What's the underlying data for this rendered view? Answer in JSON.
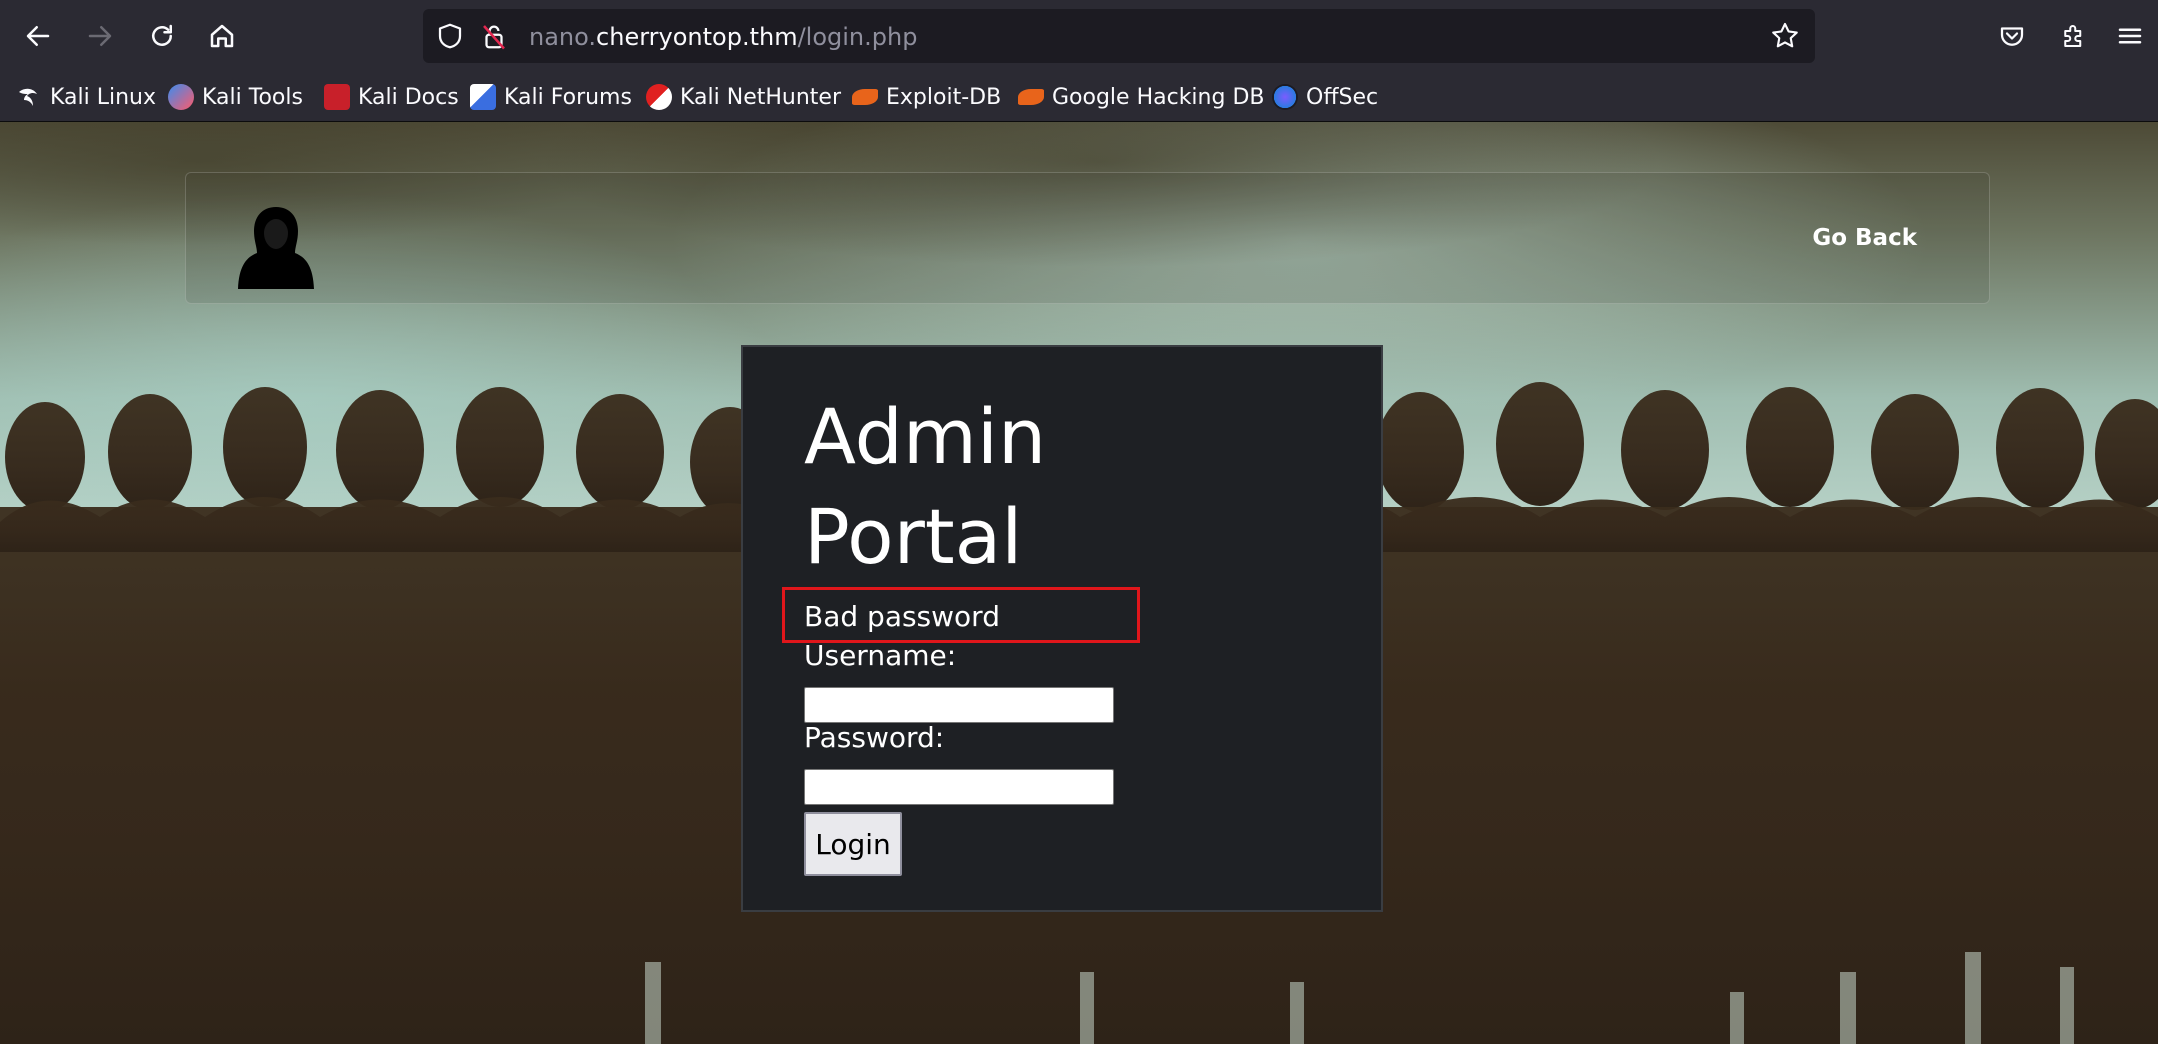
{
  "browser": {
    "url_prefix": "nano.",
    "url_host": "cherryontop.thm",
    "url_path": "/login.php",
    "bookmarks": [
      {
        "label": "Kali Linux",
        "icon": "kali-dragon-icon"
      },
      {
        "label": "Kali Tools",
        "icon": "kali-tools-icon"
      },
      {
        "label": "Kali Docs",
        "icon": "kali-docs-icon"
      },
      {
        "label": "Kali Forums",
        "icon": "kali-forums-icon"
      },
      {
        "label": "Kali NetHunter",
        "icon": "kali-nethunter-icon"
      },
      {
        "label": "Exploit-DB",
        "icon": "exploit-db-icon"
      },
      {
        "label": "Google Hacking DB",
        "icon": "ghdb-icon"
      },
      {
        "label": "OffSec",
        "icon": "offsec-icon"
      }
    ]
  },
  "navbar": {
    "go_back_label": "Go Back"
  },
  "login": {
    "title": "Admin Portal",
    "error_message": "Bad password",
    "username_label": "Username:",
    "password_label": "Password:",
    "username_value": "",
    "password_value": "",
    "submit_label": "Login"
  },
  "colors": {
    "chrome_bg": "#2b2a33",
    "urlbar_bg": "#1c1b22",
    "card_bg": "#1e2024",
    "error_highlight": "#e0161b"
  }
}
